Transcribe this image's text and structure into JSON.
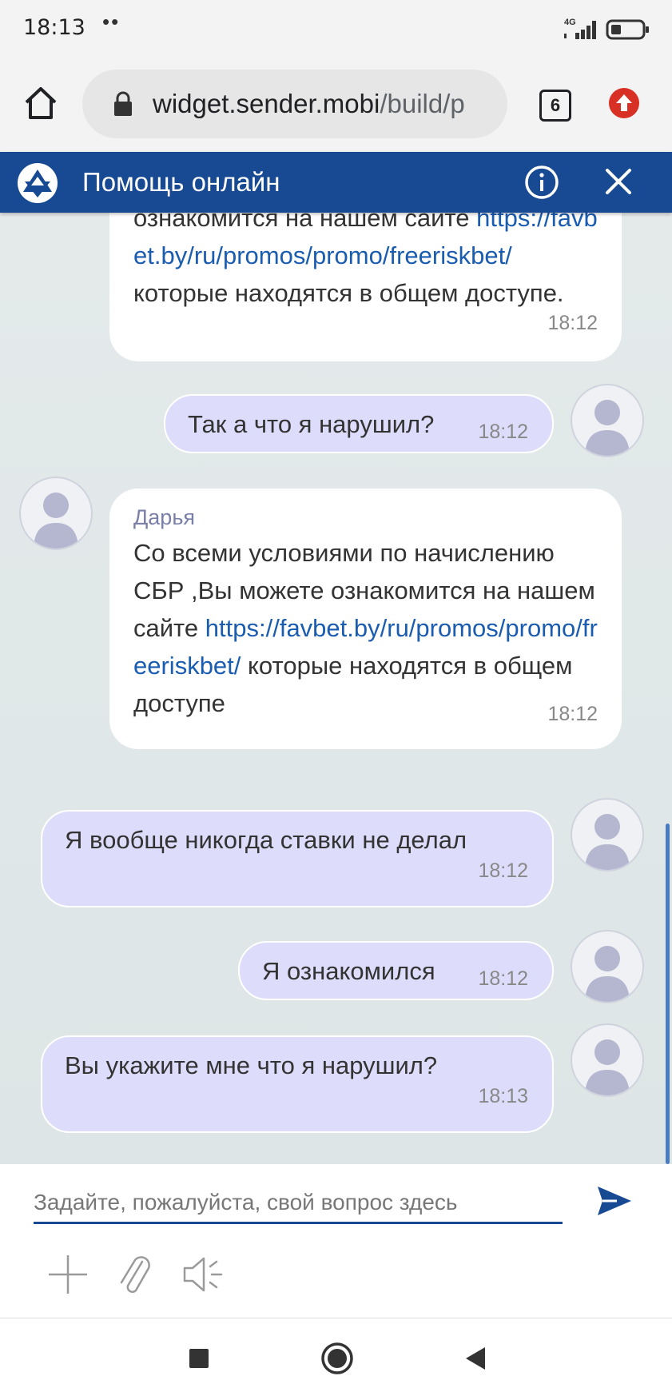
{
  "status_bar": {
    "time": "18:13",
    "dots": "••",
    "network": "4G"
  },
  "browser": {
    "url_host": "widget.sender.mobi",
    "url_path": "/build/p",
    "tab_count": "6"
  },
  "widget": {
    "title": "Помощь онлайн"
  },
  "messages": [
    {
      "text_before": "ознакомится на нашем сайте",
      "link": "https://favbet.by/ru/promos/promo/freeriskbet/",
      "text_after": " которые находятся в общем доступе.",
      "time": "18:12"
    },
    {
      "text": "Так а что я нарушил?",
      "time": "18:12"
    },
    {
      "author": "Дарья",
      "text_before": "Со всеми условиями по начислению СБР ,Вы можете ознакомится на нашем сайте",
      "link": "https://favbet.by/ru/promos/promo/freeriskbet/",
      "text_after": " которые находятся в общем доступе",
      "time": "18:12"
    },
    {
      "text": "Я вообще никогда ставки не делал",
      "time": "18:12"
    },
    {
      "text": "Я ознакомился",
      "time": "18:12"
    },
    {
      "text": "Вы укажите мне что я нарушил?",
      "time": "18:13"
    }
  ],
  "composer": {
    "placeholder": "Задайте, пожалуйста, свой вопрос здесь"
  },
  "colors": {
    "header_bg": "#174a93",
    "user_bubble": "#dedcfb",
    "link": "#1a5cb0"
  }
}
